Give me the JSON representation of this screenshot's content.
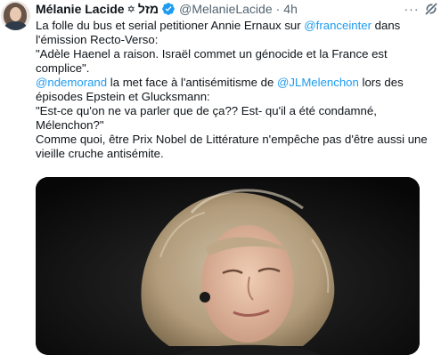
{
  "tweet": {
    "author_name": "Mélanie Lacide",
    "author_symbol": "✡",
    "author_hebrew": "מזל",
    "handle": "@MelanieLacide",
    "separator": "·",
    "time": "4h",
    "more_label": "···",
    "lines": {
      "l1a": "La folle du bus et serial petitioner Annie Ernaux sur ",
      "l1b": "@franceinter",
      "l1c": " dans",
      "l2": "l'émission Recto-Verso:",
      "l3": "\"Adèle Haenel a raison. Israël commet un génocide et la France est",
      "l4": "complice\".",
      "l5a": "@ndemorand",
      "l5b": " la met face à l'antisémitisme de ",
      "l5c": "@JLMelenchon",
      "l5d": " lors des",
      "l6": "épisodes Epstein et Glucksmann:",
      "l7": "\"Est-ce qu'on ne va parler que de ça?? Est- qu'il a été condamné,",
      "l8": "Mélenchon?\"",
      "l9": "Comme quoi, être Prix Nobel de Littérature n'empêche pas d'être aussi une",
      "l10": "vieille cruche antisémite."
    },
    "colors": {
      "link": "#1d9bf0",
      "verified": "#1d9bf0",
      "text": "#0f1419",
      "muted": "#536471"
    },
    "icons": [
      "verified-badge-icon",
      "more-icon",
      "grok-icon"
    ]
  }
}
